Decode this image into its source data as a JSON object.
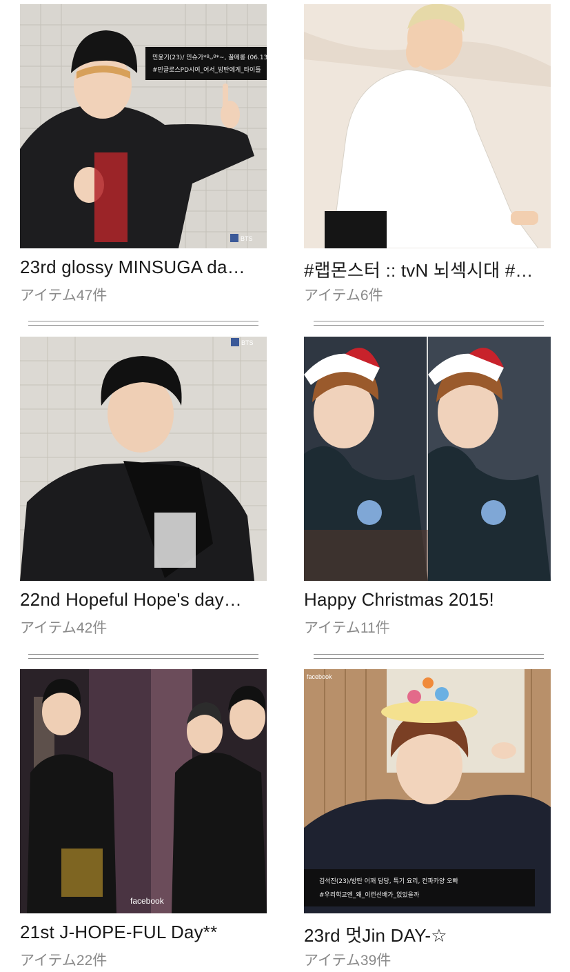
{
  "albums": [
    {
      "title": "23rd glossy MINSUGA da…",
      "count": "アイテム47件",
      "overlay": [
        "민윤기(23)/ 민슈가*ºᴗº*~, 꿀메롱 (06.13)",
        "#민글로스PD시여_어서_방탄에게_타이틀"
      ],
      "logo": "BTS"
    },
    {
      "title": "#랩몬스터 :: tvN 뇌섹시대 #…",
      "count": "アイテム6件"
    },
    {
      "title": "22nd Hopeful Hope's day…",
      "count": "アイテム42件",
      "logo": "BTS"
    },
    {
      "title": "Happy Christmas 2015!",
      "count": "アイテム11件"
    },
    {
      "title": "21st J-HOPE-FUL Day**",
      "count": "アイテム22件",
      "logo": "facebook"
    },
    {
      "title": "23rd 멋Jin DAY-☆",
      "count": "アイテム39件",
      "overlay": [
        "김석진(23)/방탄 어깨 담당, 특기 요리, 컨파카양 오빠",
        "#우리학교엔_왜_이런선배가_없었을까"
      ],
      "logo": "facebook"
    }
  ],
  "colors": {
    "title": "#1a1a1a",
    "count": "#8a8a8a",
    "separator": "#8c8c8c"
  }
}
